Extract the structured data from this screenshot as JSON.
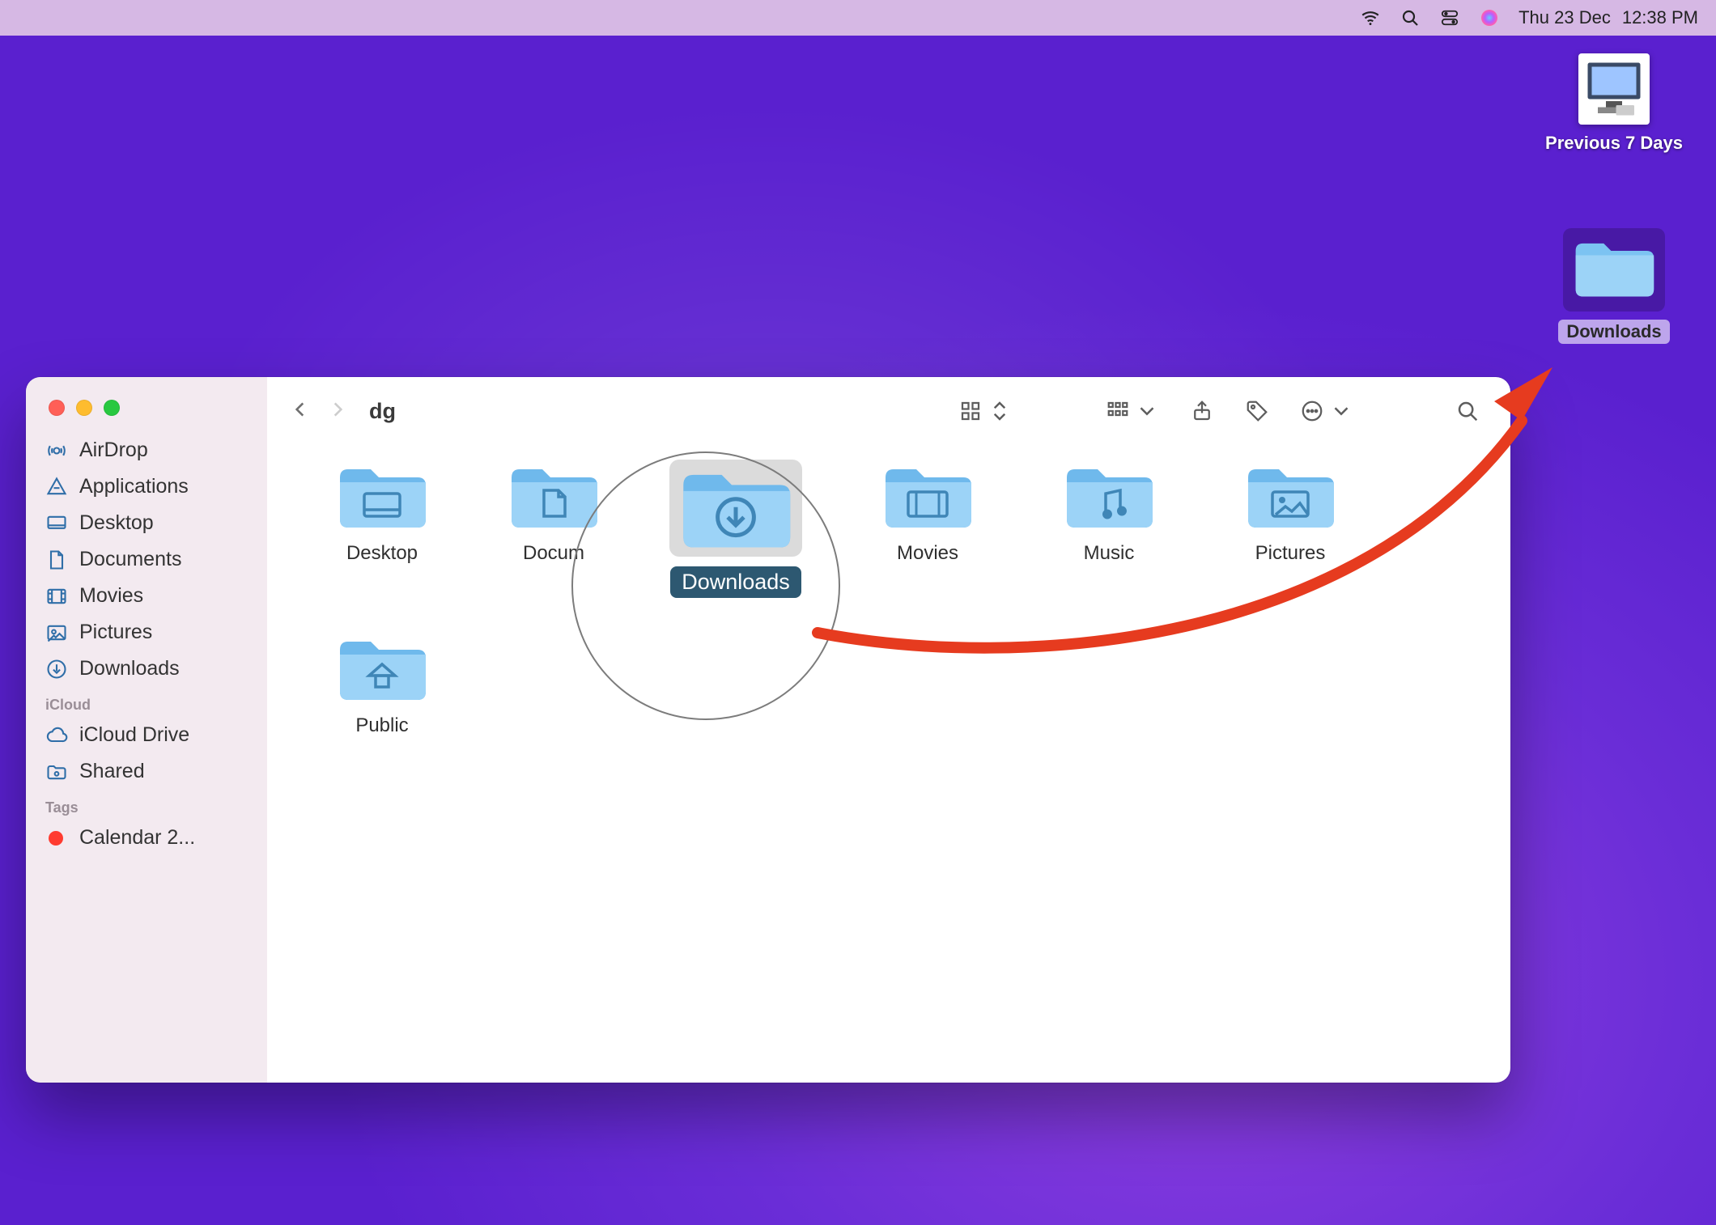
{
  "menubar": {
    "datetime_day": "Thu 23 Dec",
    "datetime_time": "12:38 PM"
  },
  "desktop": {
    "icon1_label": "Previous 7 Days",
    "icon2_label": "Downloads"
  },
  "finder": {
    "title": "dg",
    "sidebar": {
      "favorites": [
        {
          "label": "AirDrop",
          "icon": "airdrop"
        },
        {
          "label": "Applications",
          "icon": "apps"
        },
        {
          "label": "Desktop",
          "icon": "desktop"
        },
        {
          "label": "Documents",
          "icon": "documents"
        },
        {
          "label": "Movies",
          "icon": "movies"
        },
        {
          "label": "Pictures",
          "icon": "pictures"
        },
        {
          "label": "Downloads",
          "icon": "downloads"
        }
      ],
      "icloud_heading": "iCloud",
      "icloud": [
        {
          "label": "iCloud Drive",
          "icon": "cloud"
        },
        {
          "label": "Shared",
          "icon": "shared"
        }
      ],
      "tags_heading": "Tags",
      "tags": [
        {
          "label": "Calendar 2...",
          "color": "#ff3b30"
        }
      ]
    },
    "items_row1": [
      {
        "name": "Desktop",
        "kind": "folder-desktop"
      },
      {
        "name": "Documents",
        "kind": "folder-doc",
        "clip_label": "Docum"
      },
      {
        "name": "Downloads",
        "kind": "folder-down",
        "selected": true
      },
      {
        "name": "Movies",
        "kind": "folder-movies"
      },
      {
        "name": "Music",
        "kind": "folder-music"
      },
      {
        "name": "Pictures",
        "kind": "folder-pictures"
      }
    ],
    "items_row2": [
      {
        "name": "Public",
        "kind": "folder-public"
      }
    ]
  }
}
